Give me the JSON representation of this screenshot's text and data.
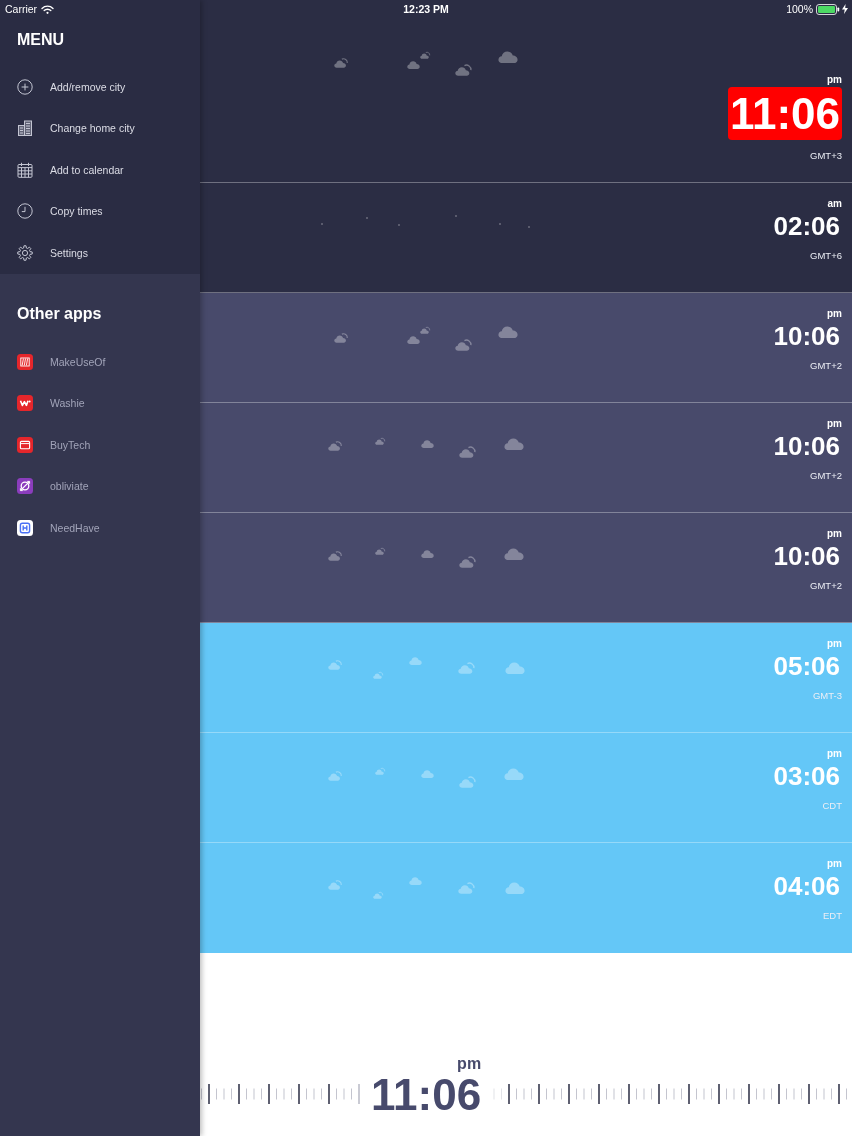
{
  "status_bar": {
    "carrier": "Carrier",
    "time": "12:23 PM",
    "battery": "100%"
  },
  "sidebar": {
    "title": "MENU",
    "menu_items": [
      "Add/remove city",
      "Change home city",
      "Add to calendar",
      "Copy times",
      "Settings"
    ],
    "apps_title": "Other apps",
    "apps": [
      "MakeUseOf",
      "Washie",
      "BuyTech",
      "obliviate",
      "NeedHave"
    ]
  },
  "cities": [
    {
      "kind": "clouds",
      "color": "#2b2d44",
      "highlighted": true,
      "period": "pm",
      "time": "11:06",
      "zone": "GMT+3"
    },
    {
      "kind": "stars",
      "color": "#2b2d44",
      "highlighted": false,
      "period": "am",
      "time": "02:06",
      "zone": "GMT+6"
    },
    {
      "kind": "clouds",
      "color": "#484a6b",
      "highlighted": false,
      "period": "pm",
      "time": "10:06",
      "zone": "GMT+2"
    },
    {
      "kind": "clouds",
      "color": "#484a6b",
      "highlighted": false,
      "period": "pm",
      "time": "10:06",
      "zone": "GMT+2"
    },
    {
      "kind": "clouds",
      "color": "#484a6b",
      "highlighted": false,
      "period": "pm",
      "time": "10:06",
      "zone": "GMT+2"
    },
    {
      "kind": "clouds",
      "color": "#64c7f7",
      "highlighted": false,
      "period": "pm",
      "time": "05:06",
      "zone": "GMT-3"
    },
    {
      "kind": "clouds",
      "color": "#64c7f7",
      "highlighted": false,
      "period": "pm",
      "time": "03:06",
      "zone": "CDT"
    },
    {
      "kind": "clouds",
      "color": "#64c7f7",
      "highlighted": false,
      "period": "pm",
      "time": "04:06",
      "zone": "EDT"
    }
  ],
  "scrubber": {
    "period": "pm",
    "time": "11:06"
  }
}
